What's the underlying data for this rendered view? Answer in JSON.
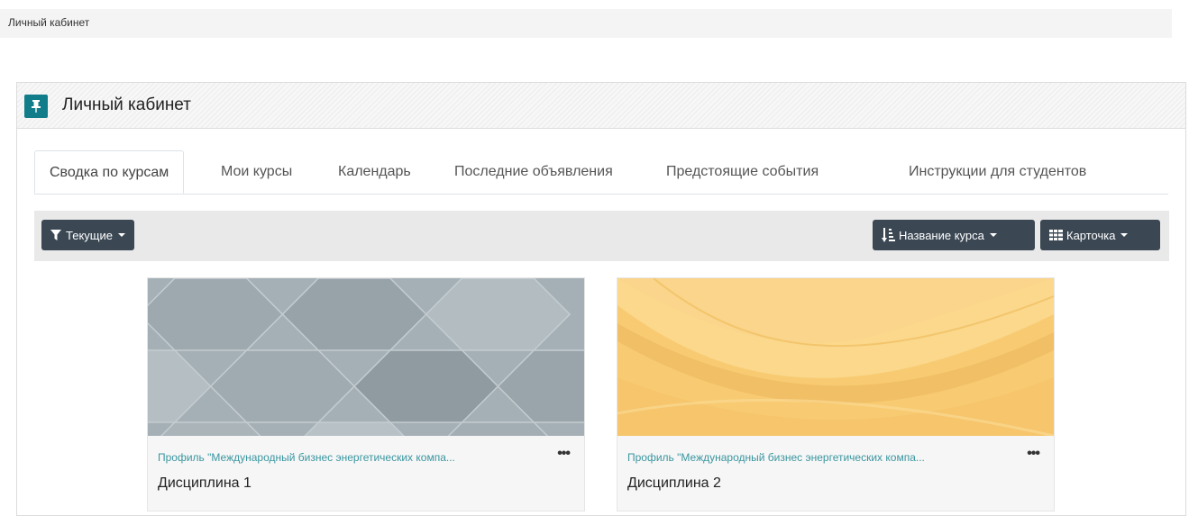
{
  "breadcrumb": {
    "label": "Личный кабинет"
  },
  "block": {
    "title": "Личный кабинет"
  },
  "tabs": [
    {
      "label": "Сводка по курсам",
      "active": true
    },
    {
      "label": "Мои курсы"
    },
    {
      "label": "Календарь"
    },
    {
      "label": "Последние объявления"
    },
    {
      "label": "Предстоящие события"
    },
    {
      "label": "Инструкции для студентов"
    }
  ],
  "toolbar": {
    "filter_label": "Текущие",
    "sort_label": "Название курса",
    "view_label": "Карточка"
  },
  "courses": [
    {
      "category": "Профиль \"Международный бизнес энергетических компа...",
      "name": "Дисциплина 1",
      "image": "grey-hexagon-pattern"
    },
    {
      "category": "Профиль \"Международный бизнес энергетических компа...",
      "name": "Дисциплина 2",
      "image": "yellow-wave-pattern"
    }
  ],
  "colors": {
    "accent": "#127d8a",
    "button": "#3b4854",
    "link": "#3a96a0"
  }
}
